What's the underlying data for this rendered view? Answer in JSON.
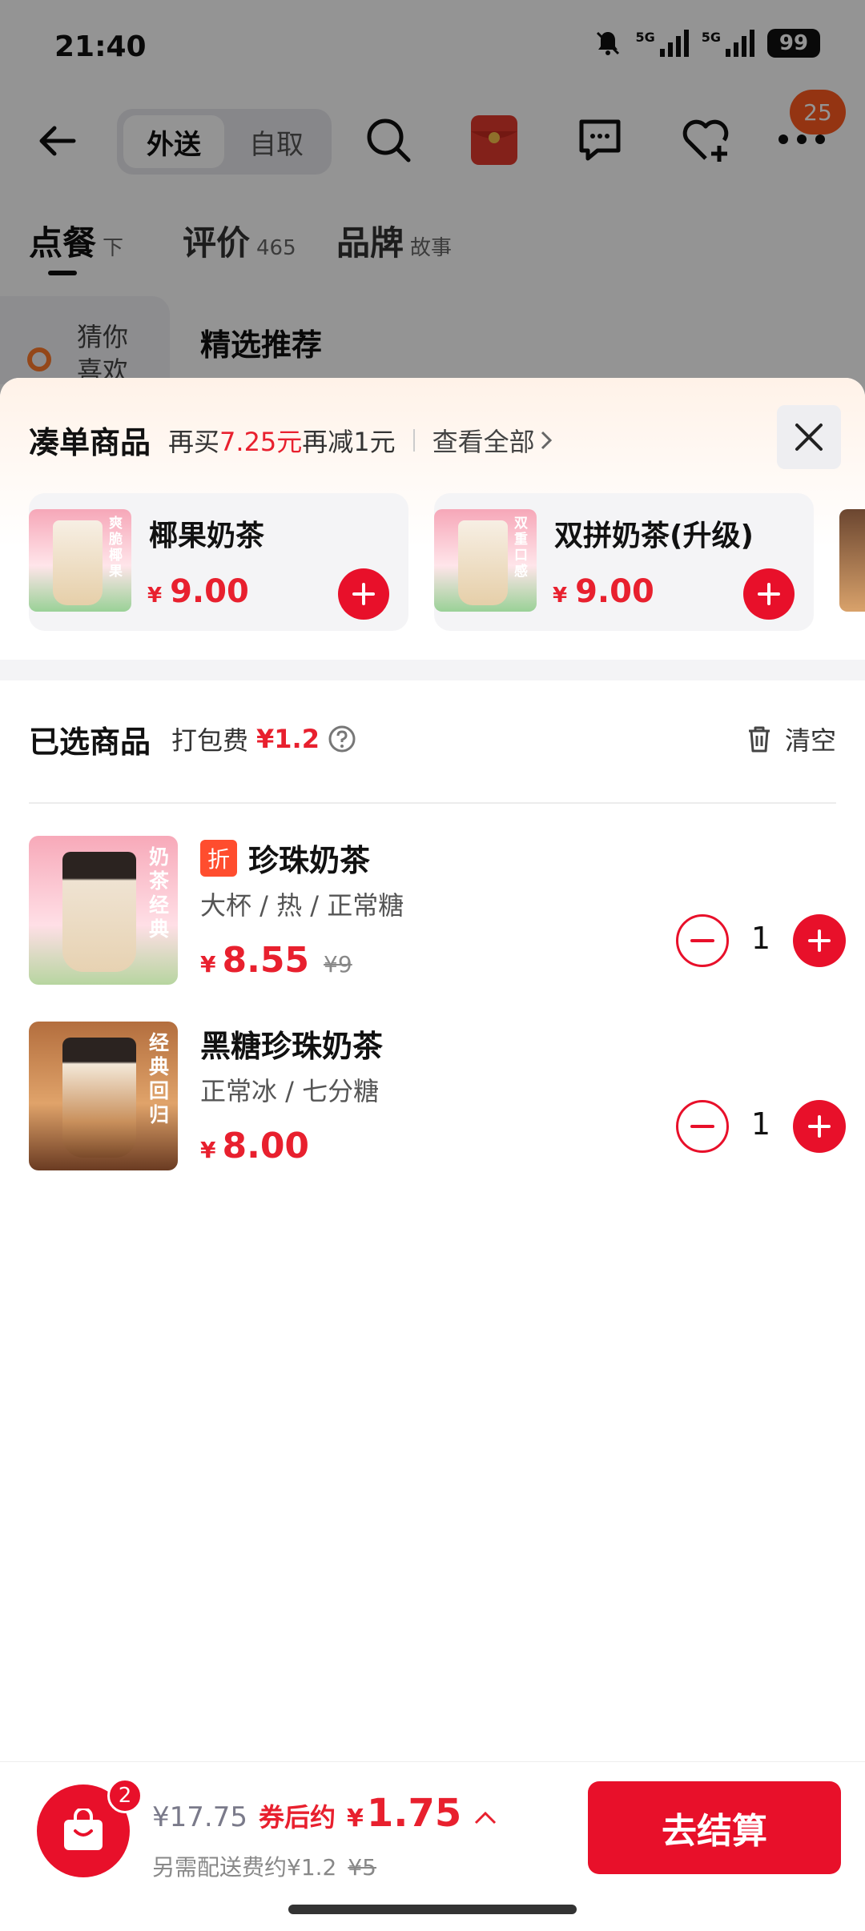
{
  "status_bar": {
    "time": "21:40",
    "battery": "99",
    "network": "5G"
  },
  "top_nav": {
    "modes": [
      "外送",
      "自取"
    ],
    "more_badge": "25"
  },
  "tabs": [
    {
      "main": "点餐",
      "sub": "下"
    },
    {
      "main": "评价",
      "sub": "465"
    },
    {
      "main": "品牌",
      "sub": "故事"
    }
  ],
  "side_category": "猜你喜欢",
  "section_title": "精选推荐",
  "addon": {
    "title": "凑单商品",
    "hint_prefix": "再买",
    "hint_amount": "7.25元",
    "hint_suffix": "再减1元",
    "view_all": "查看全部",
    "items": [
      {
        "name": "椰果奶茶",
        "currency": "¥",
        "price": "9.00",
        "img_text": "爽脆椰果",
        "img_icon": "hot-cold"
      },
      {
        "name": "双拼奶茶(升级)",
        "currency": "¥",
        "price": "9.00",
        "img_text": "双重口感",
        "img_icon": "hot-cold"
      }
    ]
  },
  "selected": {
    "title": "已选商品",
    "pack_fee_label": "打包费",
    "pack_fee": "¥1.2",
    "clear_label": "清空",
    "items": [
      {
        "badge": "折",
        "name": "珍珠奶茶",
        "spec": "大杯 / 热 / 正常糖",
        "currency": "¥",
        "price": "8.55",
        "original_price": "¥9",
        "quantity": "1",
        "img_text": "奶茶经典"
      },
      {
        "name": "黑糖珍珠奶茶",
        "spec": "正常冰 / 七分糖",
        "currency": "¥",
        "price": "8.00",
        "quantity": "1",
        "img_text": "经典回归"
      }
    ]
  },
  "bottom_bar": {
    "cart_count": "2",
    "original_total": "¥17.75",
    "after_coupon_label": "券后约",
    "after_coupon_currency": "¥",
    "after_coupon_total": "1.75",
    "delivery_text": "另需配送费约¥1.2",
    "delivery_original": "¥5",
    "checkout_label": "去结算"
  },
  "colors": {
    "accent": "#e8102a",
    "price_red": "#e8202e",
    "badge_orange": "#ff5a1f"
  }
}
